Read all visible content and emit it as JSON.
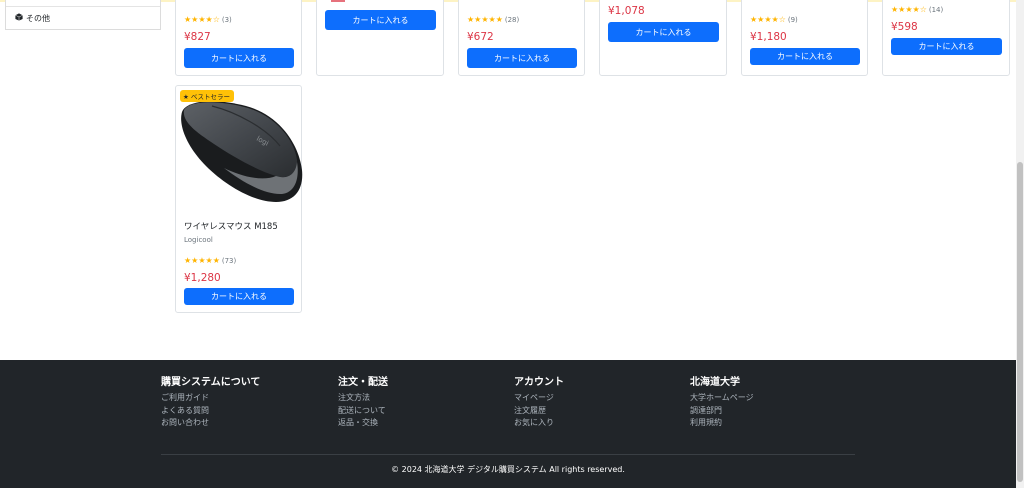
{
  "sidebar": {
    "other_label": "その他"
  },
  "products_top": [
    {
      "stars": "★★★★☆",
      "count": "(3)",
      "price": "¥827",
      "button": "カートに入れる"
    },
    {
      "stars": "",
      "count": "",
      "price": "",
      "button": "カートに入れる"
    },
    {
      "stars": "★★★★★",
      "count": "(28)",
      "price": "¥672",
      "button": "カートに入れる"
    },
    {
      "stars": "",
      "count": "",
      "price": "¥1,078",
      "button": "カートに入れる"
    },
    {
      "stars": "★★★★☆",
      "count": "(9)",
      "price": "¥1,180",
      "button": "カートに入れる"
    },
    {
      "stars": "★★★★☆",
      "count": "(14)",
      "price": "¥598",
      "button": "カートに入れる"
    }
  ],
  "product_mouse": {
    "badge": "ベストセラー",
    "name": "ワイヤレスマウス M185",
    "brand": "Logicool",
    "stars": "★★★★★",
    "count": "(73)",
    "price": "¥1,280",
    "button": "カートに入れる",
    "image_icon": "wireless-mouse-photo",
    "rating": 5
  },
  "footer": {
    "col1": {
      "title": "購買システムについて",
      "links": [
        "ご利用ガイド",
        "よくある質問",
        "お問い合わせ"
      ]
    },
    "col2": {
      "title": "注文・配送",
      "links": [
        "注文方法",
        "配送について",
        "返品・交換"
      ]
    },
    "col3": {
      "title": "アカウント",
      "links": [
        "マイページ",
        "注文履歴",
        "お気に入り"
      ]
    },
    "col4": {
      "title": "北海道大学",
      "links": [
        "大学ホームページ",
        "調達部門",
        "利用規約"
      ]
    },
    "copyright": "© 2024 北海道大学 デジタル購買システム All rights reserved."
  },
  "colors": {
    "primary": "#0d6efd",
    "price": "#dc3545",
    "star": "#ffb400",
    "badge": "#ffc107",
    "footer_bg": "#212529"
  }
}
